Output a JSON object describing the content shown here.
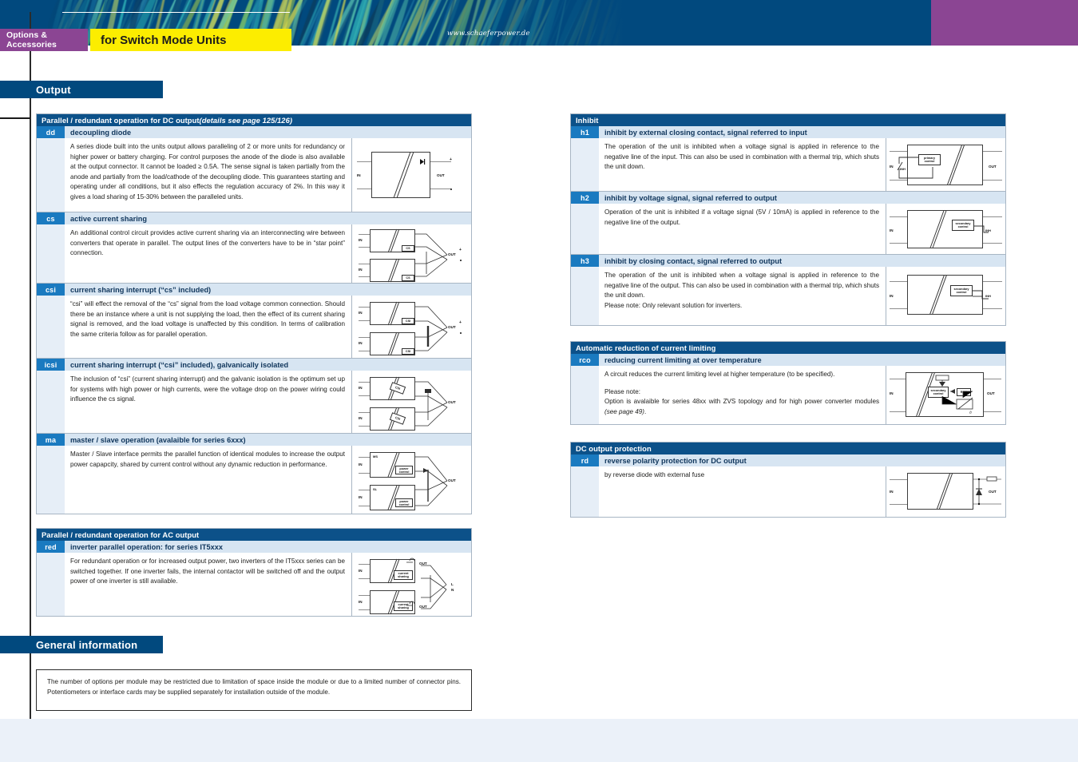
{
  "banner": {
    "category_tab": "Options & Accessories",
    "title_tab": "for Switch Mode Units",
    "url": "www.schaeferpower.de"
  },
  "sections": {
    "output_heading": "Output",
    "general_heading": "General information"
  },
  "general_info": {
    "text": "The number of options per module may be restricted due to limitation of space inside the module or due to a limited number of connector pins. Potentiometers or interface cards may be supplied separately for installation outside of the module."
  },
  "colors": {
    "brand_blue": "#01497e",
    "table_header_blue": "#0c5189",
    "code_badge_blue": "#1a7ac0",
    "sub_row_blue": "#d7e5f2",
    "gutter_blue": "#e6eef7",
    "purple": "#8b4593",
    "yellow": "#fced00",
    "bottom_band": "#ebf1f9"
  },
  "tables": {
    "dc_parallel": {
      "header": "Parallel / redundant operation for DC output ",
      "header_italic": "(details see page 125/126)",
      "rows": [
        {
          "code": "dd",
          "label": "decoupling diode",
          "text": "A series diode built into the units output allows paralleling of 2 or more units for redundancy or higher power or battery charging. For control purposes the anode of the diode is also available at the output connector. It cannot be loaded ≥ 0.5A. The sense signal is taken partially from the anode and partially from the load/cathode of the decoupling diode. This guarantees starting and operating under all conditions, but it also effects the regulation accuracy of 2%. In this way it gives a load sharing of 15-30% between the paralleled units.",
          "diagram": "dd"
        },
        {
          "code": "cs",
          "label": "active current sharing",
          "text": "An additional control circuit provides active current sharing via an interconnecting wire between converters that operate in parallel. The output lines of the converters have to be in “star point” connection.",
          "diagram": "cs"
        },
        {
          "code": "csi",
          "label": "current sharing interrupt (“cs” included)",
          "text": "“csi” will effect the removal of the “cs” signal from the load voltage common connection. Should there be an instance where a unit is not supplying the load, then the effect of its current sharing signal is removed, and the load voltage is unaffected by this condition. In terms of calibration the same criteria follow as for parallel operation.",
          "diagram": "csi"
        },
        {
          "code": "icsi",
          "label": "current sharing interrupt (“csi” included), galvanically isolated",
          "text": "The inclusion of “csi” (current sharing interrupt) and the galvanic isolation is the optimum set up for systems with high power or high currents, were the voltage drop on the power wiring could influence the cs signal.",
          "diagram": "icsi"
        },
        {
          "code": "ma",
          "label": "master / slave operation (avalaible for series 6xxx)",
          "text": "Master / Slave interface permits the parallel function of identical modules to increase the output power capapcity, shared by current control without any dynamic reduction in performance.",
          "diagram": "ma"
        }
      ]
    },
    "ac_parallel": {
      "header": "Parallel / redundant operation for AC output",
      "rows": [
        {
          "code": "red",
          "label": "inverter parallel operation: for series IT5xxx",
          "text": "For redundant operation or for increased output power, two inverters of the IT5xxx series can be switched together. If one inverter fails, the internal contactor will be switched off and the output power of one inverter is still available.",
          "diagram": "red"
        }
      ]
    },
    "inhibit": {
      "header": "Inhibit",
      "rows": [
        {
          "code": "h1",
          "label": "inhibit by external closing contact, signal referred to input",
          "text": "The operation of the unit is inhibited when a voltage signal is applied in reference to the negative line of the input. This can also be used in combination with a thermal trip, which shuts the unit down.",
          "diagram": "h1"
        },
        {
          "code": "h2",
          "label": "inhibit by voltage signal, signal referred to output",
          "text": "Operation of the unit is inhibited if a voltage signal (5V / 10mA) is applied in reference to the negative line of the output.",
          "diagram": "h2"
        },
        {
          "code": "h3",
          "label": "inhibit by closing contact, signal referred to output",
          "text": "The operation of the unit is inhibited when a voltage signal is applied in reference to the negative line of the output. This can also be used in combination with a thermal trip, which shuts the unit down.",
          "text2": "Please note: Only relevant solution for inverters.",
          "diagram": "h3"
        }
      ]
    },
    "current_limiting": {
      "header": "Automatic reduction of current limiting",
      "rows": [
        {
          "code": "rco",
          "label": "reducing current limiting at over temperature",
          "text": "A circuit reduces the current limiting level at higher temperature (to be specified).",
          "text2": "Please note:",
          "text3": "Option is avalaible for series 48xx with ZVS topology and for high power converter modules ",
          "text3_italic": "(see page 49)",
          "text3_end": ".",
          "diagram": "rco"
        }
      ]
    },
    "dc_protection": {
      "header": "DC output protection",
      "rows": [
        {
          "code": "rd",
          "label": "reverse polarity protection for DC output",
          "text": "by reverse diode with external fuse",
          "diagram": "rd"
        }
      ]
    }
  },
  "diagram_labels": {
    "in": "IN",
    "out": "OUT",
    "cs": "CS",
    "csi": "CSI",
    "ms": "MS",
    "sl": "SL",
    "inh": "INH",
    "l": "L",
    "n": "N",
    "primary_control": "primary control",
    "secondary_control": "secondary control",
    "current_sharing": "current sharing",
    "power_control": "power control",
    "rco": "RCO"
  }
}
